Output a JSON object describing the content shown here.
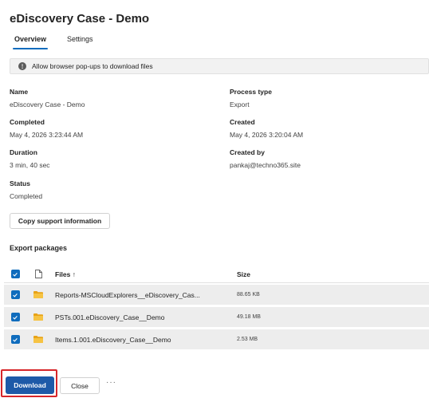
{
  "page": {
    "title": "eDiscovery Case - Demo"
  },
  "tabs": [
    {
      "label": "Overview",
      "active": true
    },
    {
      "label": "Settings",
      "active": false
    }
  ],
  "banner": {
    "icon": "info-icon",
    "text": "Allow browser pop-ups to download files"
  },
  "details": {
    "name": {
      "label": "Name",
      "value": "eDiscovery Case - Demo"
    },
    "process_type": {
      "label": "Process type",
      "value": "Export"
    },
    "completed": {
      "label": "Completed",
      "value": "May 4, 2026 3:23:44 AM"
    },
    "created": {
      "label": "Created",
      "value": "May 4, 2026 3:20:04 AM"
    },
    "duration": {
      "label": "Duration",
      "value": "3 min, 40 sec"
    },
    "created_by": {
      "label": "Created by",
      "value": "pankaj@techno365.site"
    },
    "status": {
      "label": "Status",
      "value": "Completed"
    }
  },
  "copy_button": "Copy support information",
  "export_packages": {
    "title": "Export packages",
    "columns": {
      "files": "Files ↑",
      "size": "Size"
    },
    "rows": [
      {
        "name": "Reports-MSCloudExplorers__eDiscovery_Cas...",
        "size": "88.65 KB",
        "checked": true
      },
      {
        "name": "PSTs.001.eDiscovery_Case__Demo",
        "size": "49.18 MB",
        "checked": true
      },
      {
        "name": "Items.1.001.eDiscovery_Case__Demo",
        "size": "2.53 MB",
        "checked": true
      }
    ]
  },
  "footer": {
    "download": "Download",
    "close": "Close",
    "more": "···"
  },
  "colors": {
    "accent": "#0f6cbd",
    "primary_button": "#1e5aa8",
    "highlight": "#d7262a",
    "folder": "#e8a317"
  }
}
